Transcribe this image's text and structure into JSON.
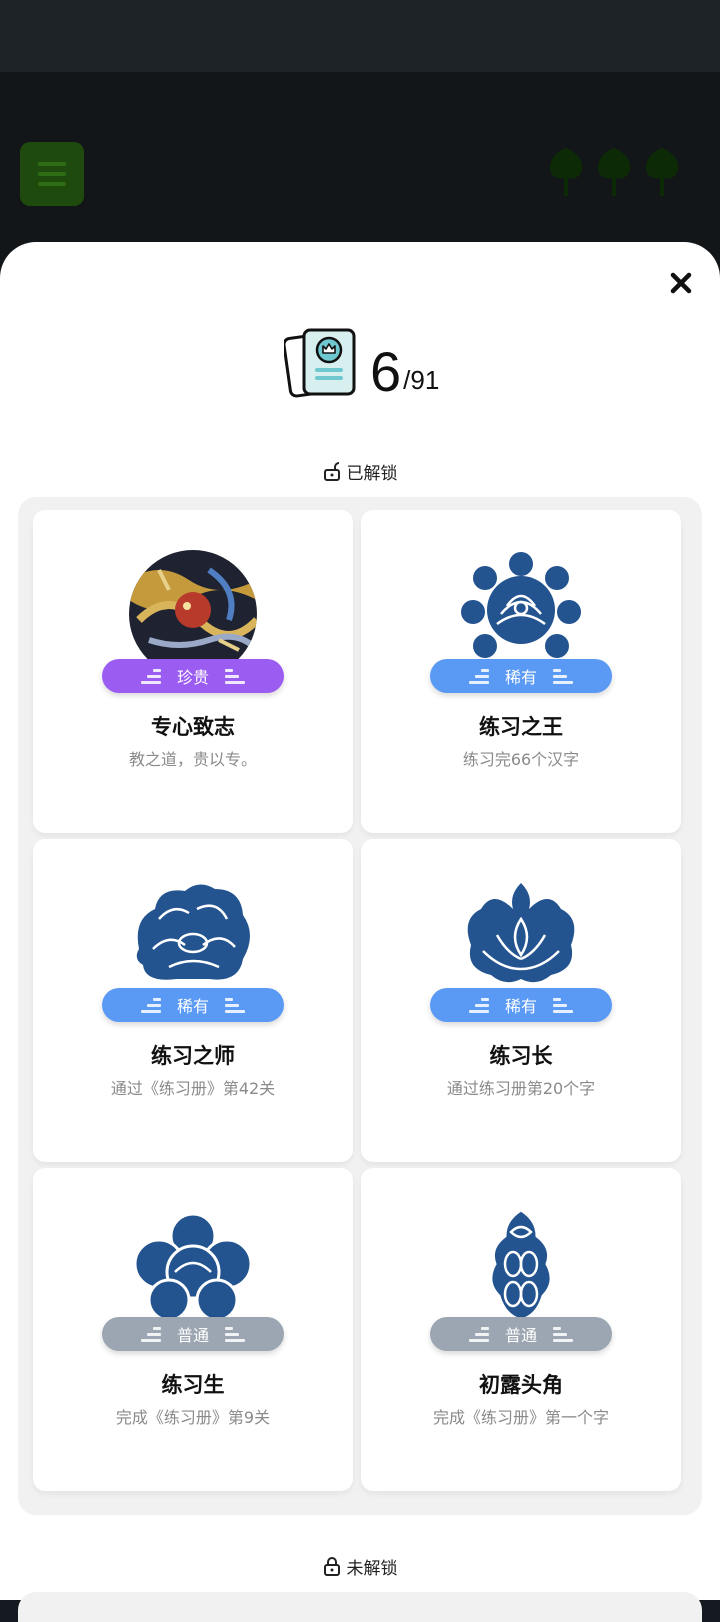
{
  "collection": {
    "unlocked_count": "6",
    "total": "/91"
  },
  "sections": {
    "unlocked_label": "已解锁",
    "locked_label": "未解锁"
  },
  "colors": {
    "rare_purple": "#9b5cf2",
    "rare_blue": "#5a9af5",
    "common_gray": "#9ba6b2",
    "emblem_blue": "#23548f"
  },
  "cards": [
    {
      "badge": "珍贵",
      "title": "专心致志",
      "desc": "教之道，贵以专。",
      "icon": "dragon-embroidery-icon"
    },
    {
      "badge": "稀有",
      "title": "练习之王",
      "desc": "练习完66个汉字",
      "icon": "peony-medallion-icon"
    },
    {
      "badge": "稀有",
      "title": "练习之师",
      "desc": "通过《练习册》第42关",
      "icon": "peony-bloom-icon"
    },
    {
      "badge": "稀有",
      "title": "练习长",
      "desc": "通过练习册第20个字",
      "icon": "lotus-flower-icon"
    },
    {
      "badge": "普通",
      "title": "练习生",
      "desc": "完成《练习册》第9关",
      "icon": "cloud-flower-icon"
    },
    {
      "badge": "普通",
      "title": "初露头角",
      "desc": "完成《练习册》第一个字",
      "icon": "ornament-pendant-icon"
    }
  ]
}
